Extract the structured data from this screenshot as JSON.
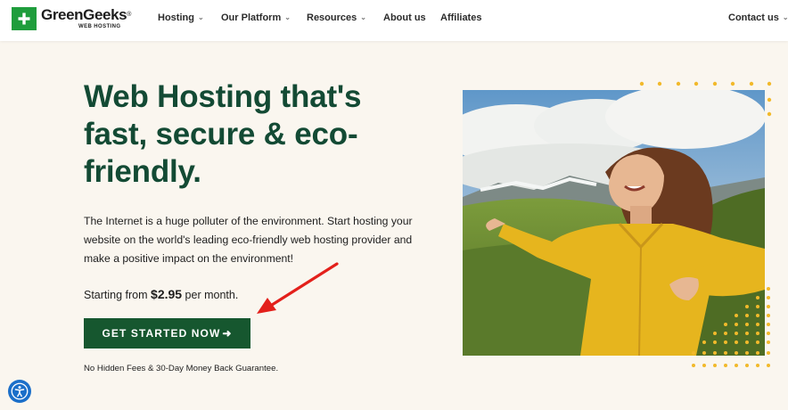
{
  "brand": {
    "name": "GreenGeeks",
    "trademark": "®",
    "subtitle": "WEB HOSTING",
    "logo_color": "#1f9d3c"
  },
  "nav": {
    "items": [
      {
        "label": "Hosting",
        "dropdown": true
      },
      {
        "label": "Our Platform",
        "dropdown": true
      },
      {
        "label": "Resources",
        "dropdown": true
      },
      {
        "label": "About us",
        "dropdown": false
      },
      {
        "label": "Affiliates",
        "dropdown": false
      }
    ],
    "contact": {
      "label": "Contact us",
      "dropdown": true
    }
  },
  "hero": {
    "headline": "Web Hosting that's fast, secure & eco-friendly.",
    "intro": "The Internet is a huge polluter of the environment. Start hosting your website on the world's leading eco-friendly web hosting provider and make a positive impact on the environment!",
    "price_prefix": "Starting from ",
    "price_amount": "$2.95",
    "price_suffix": " per month.",
    "cta_label": "GET STARTED NOW",
    "guarantee": "No Hidden Fees & 30-Day Money Back Guarantee."
  },
  "icons": {
    "logo": "plus-icon",
    "dropdown": "chevron-down-icon",
    "cta": "arrow-right-icon",
    "annotation": "red-arrow-icon",
    "accessibility": "accessibility-icon"
  },
  "colors": {
    "headline": "#134a34",
    "cta_bg": "#16572f",
    "page_bg": "#faf6ef",
    "dots": "#f2b92b",
    "annotation": "#e3201b",
    "jacket": "#e6b51e",
    "accessibility": "#1b6fc9"
  }
}
